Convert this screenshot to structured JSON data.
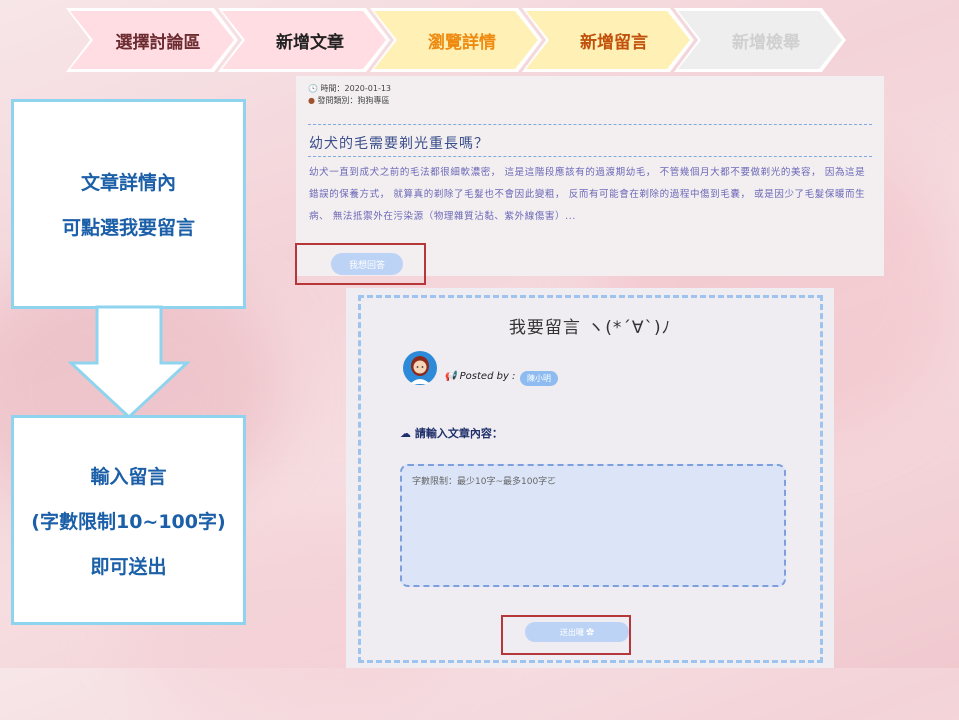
{
  "steps": [
    {
      "label": "選擇討論區",
      "bg": "#ffdde3",
      "color": "#6b2b30"
    },
    {
      "label": "新增文章",
      "bg": "#ffdde3",
      "color": "#222222"
    },
    {
      "label": "瀏覽詳情",
      "bg": "#fff0b5",
      "color": "#ef8a10"
    },
    {
      "label": "新增留言",
      "bg": "#fff0b5",
      "color": "#c2510c"
    },
    {
      "label": "新增檢舉",
      "bg": "#eeeeee",
      "color": "#d5d5d5"
    }
  ],
  "notes": {
    "top": {
      "line1": "文章詳情內",
      "line2": "可點選我要留言"
    },
    "bottom": {
      "line1": "輸入留言",
      "line2": "(字數限制10~100字)",
      "line3": "即可送出"
    }
  },
  "article": {
    "time_label": "時間：2020-01-13",
    "category_label": "發問類別：狗狗專區",
    "title": "幼犬的毛需要剃光重長嗎？",
    "body": "幼犬一直到成犬之前的毛法都很細軟濃密， 這是這階段應該有的過渡期幼毛， 不管幾個月大都不要做剃光的美容， 因為這是錯誤的保養方式， 就算真的剃除了毛髮也不會因此變粗， 反而有可能會在剃除的過程中傷到毛囊， 或是因少了毛髮保暖而生病、 無法抵禦外在污染源（物理雜質沾黏、紫外線傷害）...",
    "reply_button": "我想回答"
  },
  "comment_panel": {
    "title": "我要留言 ヽ(*´∀`)ﾉ",
    "posted_by": "Posted by :",
    "author": "陳小明",
    "prompt": "請輸入文章內容：",
    "placeholder": "字數限制：最少10字~最多100字ㄛ",
    "value": "",
    "send_button": "送出囉 ✿"
  },
  "colors": {
    "highlight": "#b5373a",
    "note_border": "#8fd4ee",
    "note_text": "#1b5fa8",
    "button": "#bcd3f5"
  }
}
